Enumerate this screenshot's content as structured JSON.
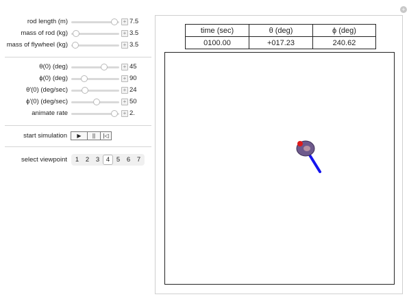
{
  "controls": {
    "sliders": [
      {
        "label": "rod length (m)",
        "value": "7.5",
        "fraction": 0.9
      },
      {
        "label": "mass of rod (kg)",
        "value": "3.5",
        "fraction": 0.1
      },
      {
        "label": "mass of flywheel (kg)",
        "value": "3.5",
        "fraction": 0.08
      }
    ],
    "initial": [
      {
        "label": "θ(0) (deg)",
        "value": "45",
        "fraction": 0.69
      },
      {
        "label": "ϕ(0) (deg)",
        "value": "90",
        "fraction": 0.27
      },
      {
        "label": "θ′(0) (deg/sec)",
        "value": "24",
        "fraction": 0.29
      },
      {
        "label": "ϕ′(0) (deg/sec)",
        "value": "50",
        "fraction": 0.53
      },
      {
        "label": "animate rate",
        "value": "2.",
        "fraction": 0.9
      }
    ],
    "simulation": {
      "label": "start simulation",
      "play": "▶",
      "pause": "||",
      "reset": "|◁"
    },
    "viewpoint": {
      "label": "select viewpoint",
      "options": [
        "1",
        "2",
        "3",
        "4",
        "5",
        "6",
        "7"
      ],
      "selected": "4"
    }
  },
  "readout": {
    "headers": {
      "time": "time (sec)",
      "theta": "θ (deg)",
      "phi": "ϕ (deg)"
    },
    "values": {
      "time": "0100.00",
      "theta": "+017.23",
      "phi": "240.62"
    }
  },
  "colors": {
    "rod": "#1515ee",
    "flywheel": "#6e5a8c",
    "marker": "#e01a1a"
  },
  "icons": {
    "reset": "plus-icon"
  }
}
